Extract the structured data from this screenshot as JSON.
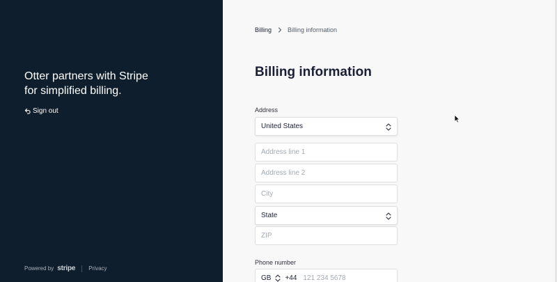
{
  "sidebar": {
    "tagline": "Otter partners with Stripe for simplified billing.",
    "sign_out": "Sign out",
    "powered_by": "Powered by",
    "brand": "stripe",
    "privacy": "Privacy"
  },
  "breadcrumb": {
    "parent": "Billing",
    "current": "Billing information"
  },
  "page_title": "Billing information",
  "address": {
    "label": "Address",
    "country": "United States",
    "line1_placeholder": "Address line 1",
    "line2_placeholder": "Address line 2",
    "city_placeholder": "City",
    "state": "State",
    "zip_placeholder": "ZIP"
  },
  "phone": {
    "label": "Phone number",
    "country_code": "GB",
    "prefix": "+44",
    "placeholder": "121 234 5678"
  },
  "colors": {
    "sidebar_bg": "#0f1e2c",
    "content_bg": "#f8f8f8",
    "text_primary": "#1a1f36",
    "placeholder": "#a3a9b2"
  },
  "icons": {
    "sign_out": "sign-out-arrow-icon",
    "breadcrumb_separator": "chevron-right-icon",
    "select": "chevron-up-down-icon",
    "pointer": "mouse-cursor-icon"
  }
}
